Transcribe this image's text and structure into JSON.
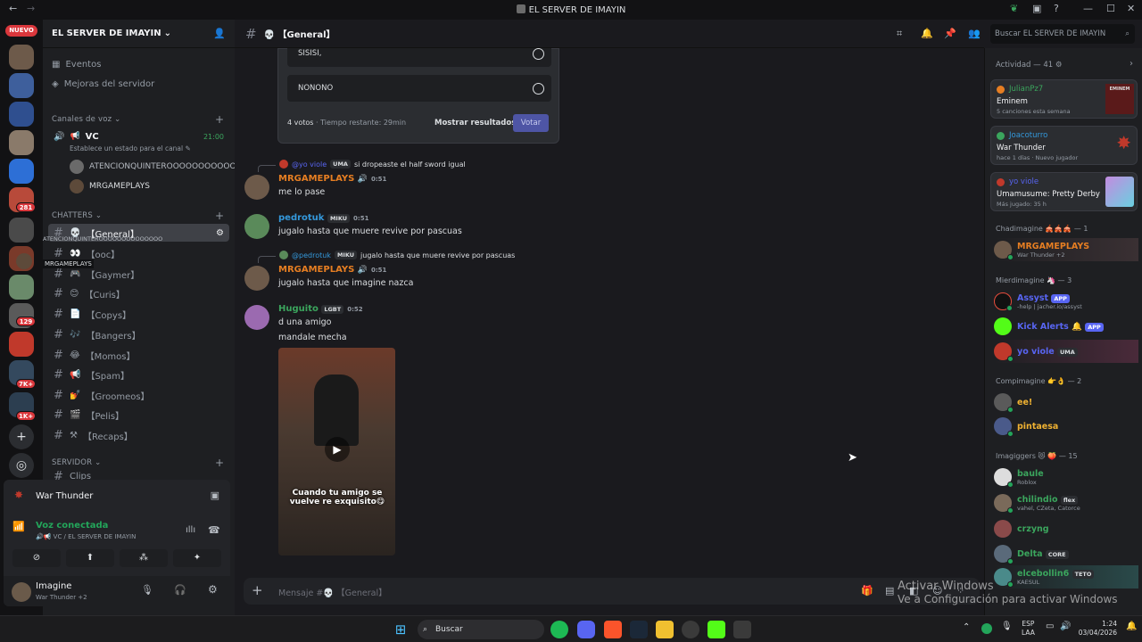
{
  "window": {
    "title": "EL SERVER DE IMAYIN"
  },
  "rail": {
    "new_badge": "NUEVO",
    "badges": [
      "281",
      "129",
      "7K+",
      "1K+"
    ]
  },
  "server": {
    "name": "EL SERVER DE IMAYIN",
    "events": "Eventos",
    "boost": "Mejoras del servidor"
  },
  "voice_category": "Canales de voz",
  "voice_channel": {
    "name": "VC",
    "time": "21:00",
    "status_hint": "Establece un estado para el canal",
    "members": [
      "ATENCIONQUINTEROOOOOOOOOOO...",
      "MRGAMEPLAYS"
    ]
  },
  "chatters_category": "CHATTERS",
  "channels": [
    {
      "icon": "💀",
      "name": "【General】"
    },
    {
      "icon": "👀",
      "name": "【ooc】"
    },
    {
      "icon": "🎮",
      "name": "【Gaymer】"
    },
    {
      "icon": "😊",
      "name": "【Curis】"
    },
    {
      "icon": "📄",
      "name": "【Copys】"
    },
    {
      "icon": "🎶",
      "name": "【Bangers】"
    },
    {
      "icon": "😂",
      "name": "【Momos】"
    },
    {
      "icon": "📢",
      "name": "【Spam】"
    },
    {
      "icon": "💅",
      "name": "【Groomeos】"
    },
    {
      "icon": "🎬",
      "name": "【Pelis】"
    },
    {
      "icon": "⚒",
      "name": "【Recaps】"
    }
  ],
  "drag_overlay": {
    "line1": "ATENCIONQUINTEROOOOOOOOOOOOOO",
    "line2": "MRGAMEPLAYS"
  },
  "server_category": "SERVIDOR",
  "partial_channel": "Clips",
  "game_panel": {
    "game": "War Thunder",
    "voice_status": "Voz conectada",
    "voice_path": "🔊📢 VC / EL SERVER DE IMAYIN"
  },
  "user_panel": {
    "name": "Imagine",
    "status": "War Thunder +2"
  },
  "channel_header": {
    "name": "💀 【General】"
  },
  "search": {
    "placeholder": "Buscar EL SERVER DE IMAYIN"
  },
  "poll": {
    "options": [
      "SISISI,",
      "NONONO"
    ],
    "votes": "4 votos",
    "remaining": "Tiempo restante: 29min",
    "show_results": "Mostrar resultados",
    "vote": "Votar"
  },
  "messages": [
    {
      "reply_user": "@yo viole",
      "reply_tag": "UMA",
      "reply_text": "si dropeaste el half sword igual",
      "user": "MRGAMEPLAYS",
      "time": "0:51",
      "lines": [
        "me lo pase"
      ]
    },
    {
      "user": "pedrotuk",
      "tag": "MIKU",
      "time": "0:51",
      "lines": [
        "jugalo hasta que muere revive por pascuas"
      ]
    },
    {
      "reply_user": "@pedrotuk",
      "reply_tag": "MIKU",
      "reply_text": "jugalo hasta que muere revive por pascuas",
      "user": "MRGAMEPLAYS",
      "time": "0:51",
      "lines": [
        "jugalo hasta que imagine nazca"
      ]
    },
    {
      "user": "Huguito",
      "tag": "LGBT",
      "time": "0:52",
      "lines": [
        "d una amigo",
        "mandale mecha"
      ],
      "video_caption": "Cuando tu amigo se vuelve re exquisito😋"
    }
  ],
  "composer": {
    "placeholder": "Mensaje #💀 【General】"
  },
  "activity": {
    "header": "Actividad — 41",
    "cards": [
      {
        "user": "JulianPz7",
        "title": "Eminem",
        "sub": "5 canciones esta semana",
        "thumb": "EMINEM"
      },
      {
        "user": "Joacoturro",
        "title": "War Thunder",
        "sub": "hace 1 días",
        "sub2": "Nuevo jugador"
      },
      {
        "user": "yo viole",
        "title": "Umamusume: Pretty Derby",
        "sub": "Más jugado: 35 h"
      }
    ]
  },
  "groups": [
    {
      "header": "Chadimagine 🎪🎪🎪 — 1",
      "members": [
        {
          "name": "MRGAMEPLAYS",
          "sub": "War Thunder +2",
          "color": "#e67e22"
        }
      ]
    },
    {
      "header": "Mierdimagine 🦄 — 3",
      "members": [
        {
          "name": "Assyst",
          "tag": "APP",
          "sub": "-help | jacher.io/assyst",
          "color": "#5865f2"
        },
        {
          "name": "Kick Alerts 🔔",
          "tag": "APP",
          "sub": "",
          "color": "#5865f2"
        },
        {
          "name": "yo viole",
          "tag": "UMA",
          "sub": "",
          "color": "#5865f2"
        }
      ]
    },
    {
      "header": "Compimagine 👉👌 — 2",
      "members": [
        {
          "name": "ee!",
          "sub": "",
          "color": "#f0b232"
        },
        {
          "name": "pintaesa",
          "sub": "",
          "color": "#f0b232"
        }
      ]
    },
    {
      "header": "Imagiggers 😻 🍑 — 15",
      "members": [
        {
          "name": "baule",
          "sub": "Roblox",
          "color": "#3ba55d"
        },
        {
          "name": "chilindio",
          "tag": "flex",
          "sub": "vahel, CZeta, Catorce",
          "color": "#3ba55d"
        },
        {
          "name": "crzyng",
          "sub": "",
          "color": "#3ba55d"
        },
        {
          "name": "Delta",
          "tag": "CORE",
          "sub": "",
          "color": "#3ba55d"
        },
        {
          "name": "elcebollin6",
          "tag": "TETO",
          "sub": "KAESUL",
          "color": "#3ba55d"
        }
      ]
    }
  ],
  "watermark": {
    "line1": "Activar Windows",
    "line2": "Ve a Configuración para activar Windows"
  },
  "taskbar": {
    "search": "Buscar",
    "lang1": "ESP",
    "lang2": "LAA",
    "time": "1:24",
    "date": "03/04/2026"
  }
}
